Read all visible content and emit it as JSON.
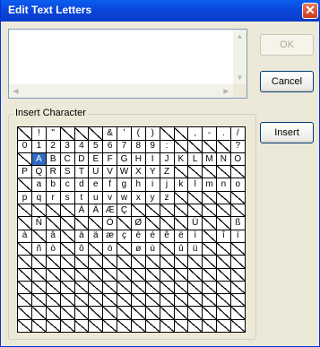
{
  "window": {
    "title": "Edit Text Letters",
    "close_glyph": "✕"
  },
  "buttons": {
    "ok": "OK",
    "cancel": "Cancel",
    "insert": "Insert"
  },
  "group": {
    "label": "Insert Character"
  },
  "text_input": {
    "value": ""
  },
  "char_grid": {
    "selected": "A",
    "rows": [
      [
        "",
        "!",
        "\"",
        "",
        "",
        "",
        "&",
        "'",
        "(",
        ")",
        "",
        "",
        ",",
        "-",
        ".",
        "/"
      ],
      [
        "0",
        "1",
        "2",
        "3",
        "4",
        "5",
        "6",
        "7",
        "8",
        "9",
        ":",
        "",
        "",
        "",
        "",
        "?"
      ],
      [
        "",
        "A",
        "B",
        "C",
        "D",
        "E",
        "F",
        "G",
        "H",
        "I",
        "J",
        "K",
        "L",
        "M",
        "N",
        "O"
      ],
      [
        "P",
        "Q",
        "R",
        "S",
        "T",
        "U",
        "V",
        "W",
        "X",
        "Y",
        "Z",
        "",
        "",
        "",
        "",
        ""
      ],
      [
        "",
        "a",
        "b",
        "c",
        "d",
        "e",
        "f",
        "g",
        "h",
        "i",
        "j",
        "k",
        "l",
        "m",
        "n",
        "o"
      ],
      [
        "p",
        "q",
        "r",
        "s",
        "t",
        "u",
        "v",
        "w",
        "x",
        "y",
        "z",
        "",
        "",
        "",
        "",
        ""
      ],
      [
        "",
        "",
        "",
        "",
        "À",
        "Ä",
        "Æ",
        "Ç",
        "",
        "",
        "",
        "",
        "",
        "",
        "",
        ""
      ],
      [
        "",
        "Ñ",
        "",
        "",
        "",
        "",
        "Ö",
        "",
        "Ø",
        "",
        "",
        "",
        "Ü",
        "",
        "",
        "ß"
      ],
      [
        "à",
        "",
        "â",
        "",
        "ä",
        "ä",
        "æ",
        "ç",
        "è",
        "é",
        "ê",
        "ë",
        "ì",
        "",
        "î",
        "ï"
      ],
      [
        "",
        "ñ",
        "ò",
        "",
        "ô",
        "",
        "ö",
        "",
        "ø",
        "ù",
        "",
        "û",
        "ü",
        "",
        "",
        ""
      ],
      [
        "",
        "",
        "",
        "",
        "",
        "",
        "",
        "",
        "",
        "",
        "",
        "",
        "",
        "",
        "",
        ""
      ],
      [
        "",
        "",
        "",
        "",
        "",
        "",
        "",
        "",
        "",
        "",
        "",
        "",
        "",
        "",
        "",
        ""
      ],
      [
        "",
        "",
        "",
        "",
        "",
        "",
        "",
        "",
        "",
        "",
        "",
        "",
        "",
        "",
        "",
        ""
      ],
      [
        "",
        "",
        "",
        "",
        "",
        "",
        "",
        "",
        "",
        "",
        "",
        "",
        "",
        "",
        "",
        ""
      ],
      [
        "",
        "",
        "",
        "",
        "",
        "",
        "",
        "",
        "",
        "",
        "",
        "",
        "",
        "",
        "",
        ""
      ],
      [
        "",
        "",
        "",
        "",
        "",
        "",
        "",
        "",
        "",
        "",
        "",
        "",
        "",
        "",
        "",
        ""
      ]
    ]
  }
}
